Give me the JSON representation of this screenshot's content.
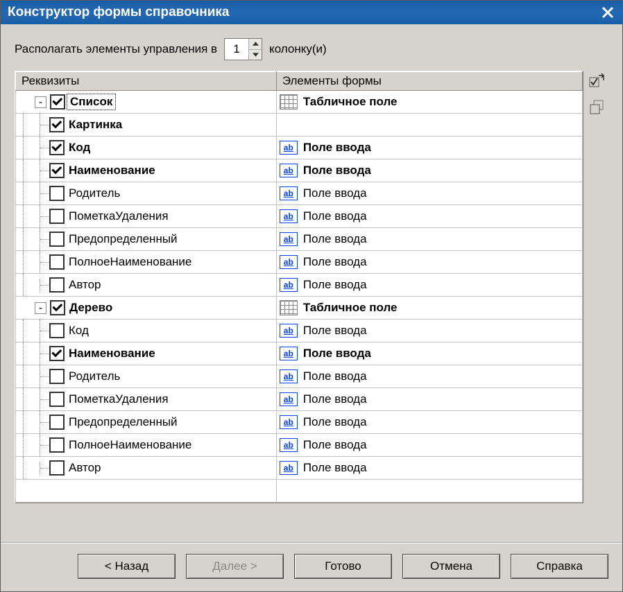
{
  "title": "Конструктор формы справочника",
  "controls_label_before": "Располагать элементы управления в",
  "controls_label_after": "колонку(и)",
  "columns_value": "1",
  "headers": {
    "left": "Реквизиты",
    "right": "Элементы формы"
  },
  "elements": {
    "table_field": "Табличное поле",
    "input_field": "Поле ввода"
  },
  "tree": [
    {
      "level": 0,
      "toggle": "-",
      "checked": true,
      "label": "Список",
      "bold": true,
      "selected": true,
      "elem": "table",
      "elem_bold": true
    },
    {
      "level": 1,
      "checked": true,
      "label": "Картинка",
      "bold": true,
      "elem": "none"
    },
    {
      "level": 1,
      "checked": true,
      "label": "Код",
      "bold": true,
      "elem": "input",
      "elem_bold": true
    },
    {
      "level": 1,
      "checked": true,
      "label": "Наименование",
      "bold": true,
      "elem": "input",
      "elem_bold": true
    },
    {
      "level": 1,
      "checked": false,
      "label": "Родитель",
      "elem": "input"
    },
    {
      "level": 1,
      "checked": false,
      "label": "ПометкаУдаления",
      "elem": "input"
    },
    {
      "level": 1,
      "checked": false,
      "label": "Предопределенный",
      "elem": "input"
    },
    {
      "level": 1,
      "checked": false,
      "label": "ПолноеНаименование",
      "elem": "input"
    },
    {
      "level": 1,
      "checked": false,
      "label": "Автор",
      "elem": "input",
      "last_child": true
    },
    {
      "level": 0,
      "toggle": "-",
      "checked": true,
      "label": "Дерево",
      "bold": true,
      "elem": "table",
      "elem_bold": true
    },
    {
      "level": 1,
      "checked": false,
      "label": "Код",
      "elem": "input"
    },
    {
      "level": 1,
      "checked": true,
      "label": "Наименование",
      "bold": true,
      "elem": "input",
      "elem_bold": true
    },
    {
      "level": 1,
      "checked": false,
      "label": "Родитель",
      "elem": "input"
    },
    {
      "level": 1,
      "checked": false,
      "label": "ПометкаУдаления",
      "elem": "input"
    },
    {
      "level": 1,
      "checked": false,
      "label": "Предопределенный",
      "elem": "input"
    },
    {
      "level": 1,
      "checked": false,
      "label": "ПолноеНаименование",
      "elem": "input"
    },
    {
      "level": 1,
      "checked": false,
      "label": "Автор",
      "elem": "input",
      "last_child": true
    }
  ],
  "buttons": {
    "back": "< Назад",
    "next": "Далее >",
    "finish": "Готово",
    "cancel": "Отмена",
    "help": "Справка"
  }
}
